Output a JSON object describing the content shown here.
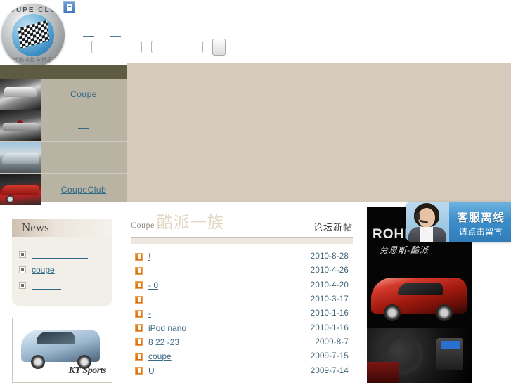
{
  "site": {
    "logo": {
      "top_text": "COUPE CLUB",
      "bottom_text": "现代酷派跑车俱乐部",
      "icon": "checkered-flag-icon"
    },
    "broken_image_icon": "broken-image-icon"
  },
  "topnav": {
    "links": [
      {
        "label": "",
        "name": "topnav-link-1"
      },
      {
        "label": "",
        "name": "topnav-link-2"
      }
    ]
  },
  "search": {
    "field1_value": "",
    "field1_placeholder": "",
    "field2_value": "",
    "field2_placeholder": "",
    "go_label": ""
  },
  "sidebar": {
    "items": [
      {
        "label": "Coupe",
        "thumb": "car-roof-photo",
        "stub": false
      },
      {
        "label": "",
        "thumb": "car-trunk-photo",
        "stub": true
      },
      {
        "label": "",
        "thumb": "car-rear-photo",
        "stub": true
      },
      {
        "label": "CoupeClub",
        "thumb": "red-car-photo",
        "stub": false
      }
    ]
  },
  "news": {
    "title": "News",
    "items": [
      {
        "label": "",
        "stub": "long"
      },
      {
        "label": "coupe",
        "stub": "none"
      },
      {
        "label": "",
        "stub": "short"
      }
    ]
  },
  "left_ad": {
    "brand": "KT Sports",
    "image": "silver-coupe-photo"
  },
  "forum": {
    "logo_en": "Coupe",
    "logo_cn": "酷派一族",
    "section_title": "论坛新帖",
    "posts": [
      {
        "title": "!",
        "date": "2010-8-28",
        "stub": true
      },
      {
        "title": "",
        "date": "2010-4-26",
        "stub": true
      },
      {
        "title": "- 0",
        "date": "2010-4-20",
        "stub": true
      },
      {
        "title": "",
        "date": "2010-3-17",
        "stub": true
      },
      {
        "title": "-",
        "date": "2010-1-16",
        "stub": true
      },
      {
        "title": "iPod nano",
        "date": "2010-1-16",
        "stub": false
      },
      {
        "title": "8 22 -23",
        "date": "2009-8-7",
        "stub": false
      },
      {
        "title": "coupe",
        "date": "2009-7-15",
        "stub": false
      },
      {
        "title": "U",
        "date": "2009-7-14",
        "stub": false
      }
    ]
  },
  "right_ad": {
    "brand": "ROHE",
    "slogan": "劳恩斯-酷派",
    "image": "red-coupe-photo"
  },
  "cs_widget": {
    "title": "客服离线",
    "subtitle": "请点击留言",
    "avatar": "customer-service-agent-photo"
  },
  "colors": {
    "olive_band": "#5f5a42",
    "beige_bg": "#d5cabc",
    "sidebar_bg": "#b8b3a2",
    "link_blue": "#2f6a86",
    "post_icon_orange": "#e8821a",
    "cs_blue": "#3d8fcb"
  }
}
